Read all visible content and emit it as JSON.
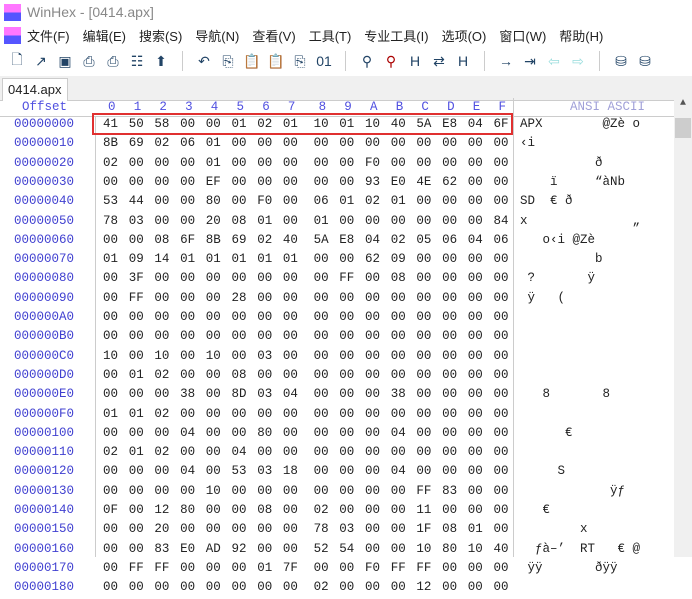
{
  "window": {
    "title": "WinHex - [0414.apx]"
  },
  "menu": [
    "文件(F)",
    "编辑(E)",
    "搜索(S)",
    "导航(N)",
    "查看(V)",
    "工具(T)",
    "专业工具(I)",
    "选项(O)",
    "窗口(W)",
    "帮助(H)"
  ],
  "toolbar": [
    "new-file",
    "open",
    "save",
    "print",
    "print-setup",
    "properties",
    "export",
    "undo",
    "copy",
    "paste",
    "paste-clipboard",
    "copy-block",
    "convert-binary",
    "find",
    "find-text",
    "find-hex",
    "replace",
    "replace-hex",
    "goto-offset",
    "goto-sector",
    "back",
    "forward",
    "disk-open",
    "disk-add"
  ],
  "tab": "0414.apx",
  "header": {
    "offset": "Offset",
    "columns": [
      "0",
      "1",
      "2",
      "3",
      "4",
      "5",
      "6",
      "7",
      "8",
      "9",
      "A",
      "B",
      "C",
      "D",
      "E",
      "F"
    ],
    "ascii": "ANSI ASCII"
  },
  "rows": [
    {
      "offset": "00000000",
      "hex": [
        "41",
        "50",
        "58",
        "00",
        "00",
        "01",
        "02",
        "01",
        "10",
        "01",
        "10",
        "40",
        "5A",
        "E8",
        "04",
        "6F"
      ],
      "ascii": "APX        @Zè o"
    },
    {
      "offset": "00000010",
      "hex": [
        "8B",
        "69",
        "02",
        "06",
        "01",
        "00",
        "00",
        "00",
        "00",
        "00",
        "00",
        "00",
        "00",
        "00",
        "00",
        "00"
      ],
      "ascii": "‹i              "
    },
    {
      "offset": "00000020",
      "hex": [
        "02",
        "00",
        "00",
        "00",
        "01",
        "00",
        "00",
        "00",
        "00",
        "00",
        "F0",
        "00",
        "00",
        "00",
        "00",
        "00"
      ],
      "ascii": "          ð     "
    },
    {
      "offset": "00000030",
      "hex": [
        "00",
        "00",
        "00",
        "00",
        "EF",
        "00",
        "00",
        "00",
        "00",
        "00",
        "93",
        "E0",
        "4E",
        "62",
        "00",
        "00"
      ],
      "ascii": "    ï     “àNb  "
    },
    {
      "offset": "00000040",
      "hex": [
        "53",
        "44",
        "00",
        "00",
        "80",
        "00",
        "F0",
        "00",
        "06",
        "01",
        "02",
        "01",
        "00",
        "00",
        "00",
        "00"
      ],
      "ascii": "SD  € ð         "
    },
    {
      "offset": "00000050",
      "hex": [
        "78",
        "03",
        "00",
        "00",
        "20",
        "08",
        "01",
        "00",
        "01",
        "00",
        "00",
        "00",
        "00",
        "00",
        "00",
        "84"
      ],
      "ascii": "x              „"
    },
    {
      "offset": "00000060",
      "hex": [
        "00",
        "00",
        "08",
        "6F",
        "8B",
        "69",
        "02",
        "40",
        "5A",
        "E8",
        "04",
        "02",
        "05",
        "06",
        "04",
        "06"
      ],
      "ascii": "   o‹i @Zè      "
    },
    {
      "offset": "00000070",
      "hex": [
        "01",
        "09",
        "14",
        "01",
        "01",
        "01",
        "01",
        "01",
        "00",
        "00",
        "62",
        "09",
        "00",
        "00",
        "00",
        "00"
      ],
      "ascii": "          b     "
    },
    {
      "offset": "00000080",
      "hex": [
        "00",
        "3F",
        "00",
        "00",
        "00",
        "00",
        "00",
        "00",
        "00",
        "FF",
        "00",
        "08",
        "00",
        "00",
        "00",
        "00"
      ],
      "ascii": " ?       ÿ      "
    },
    {
      "offset": "00000090",
      "hex": [
        "00",
        "FF",
        "00",
        "00",
        "00",
        "28",
        "00",
        "00",
        "00",
        "00",
        "00",
        "00",
        "00",
        "00",
        "00",
        "00"
      ],
      "ascii": " ÿ   (          "
    },
    {
      "offset": "000000A0",
      "hex": [
        "00",
        "00",
        "00",
        "00",
        "00",
        "00",
        "00",
        "00",
        "00",
        "00",
        "00",
        "00",
        "00",
        "00",
        "00",
        "00"
      ],
      "ascii": ""
    },
    {
      "offset": "000000B0",
      "hex": [
        "00",
        "00",
        "00",
        "00",
        "00",
        "00",
        "00",
        "00",
        "00",
        "00",
        "00",
        "00",
        "00",
        "00",
        "00",
        "00"
      ],
      "ascii": ""
    },
    {
      "offset": "000000C0",
      "hex": [
        "10",
        "00",
        "10",
        "00",
        "10",
        "00",
        "03",
        "00",
        "00",
        "00",
        "00",
        "00",
        "00",
        "00",
        "00",
        "00"
      ],
      "ascii": ""
    },
    {
      "offset": "000000D0",
      "hex": [
        "00",
        "01",
        "02",
        "00",
        "00",
        "08",
        "00",
        "00",
        "00",
        "00",
        "00",
        "00",
        "00",
        "00",
        "00",
        "00"
      ],
      "ascii": ""
    },
    {
      "offset": "000000E0",
      "hex": [
        "00",
        "00",
        "00",
        "38",
        "00",
        "8D",
        "03",
        "04",
        "00",
        "00",
        "00",
        "38",
        "00",
        "00",
        "00",
        "00"
      ],
      "ascii": "   8       8    "
    },
    {
      "offset": "000000F0",
      "hex": [
        "01",
        "01",
        "02",
        "00",
        "00",
        "00",
        "00",
        "00",
        "00",
        "00",
        "00",
        "00",
        "00",
        "00",
        "00",
        "00"
      ],
      "ascii": ""
    },
    {
      "offset": "00000100",
      "hex": [
        "00",
        "00",
        "00",
        "04",
        "00",
        "00",
        "80",
        "00",
        "00",
        "00",
        "00",
        "04",
        "00",
        "00",
        "00",
        "00"
      ],
      "ascii": "      €         "
    },
    {
      "offset": "00000110",
      "hex": [
        "02",
        "01",
        "02",
        "00",
        "00",
        "04",
        "00",
        "00",
        "00",
        "00",
        "00",
        "00",
        "00",
        "00",
        "00",
        "00"
      ],
      "ascii": ""
    },
    {
      "offset": "00000120",
      "hex": [
        "00",
        "00",
        "00",
        "04",
        "00",
        "53",
        "03",
        "18",
        "00",
        "00",
        "00",
        "04",
        "00",
        "00",
        "00",
        "00"
      ],
      "ascii": "     S          "
    },
    {
      "offset": "00000130",
      "hex": [
        "00",
        "00",
        "00",
        "00",
        "10",
        "00",
        "00",
        "00",
        "00",
        "00",
        "00",
        "00",
        "FF",
        "83",
        "00",
        "00"
      ],
      "ascii": "            ÿƒ  "
    },
    {
      "offset": "00000140",
      "hex": [
        "0F",
        "00",
        "12",
        "80",
        "00",
        "00",
        "08",
        "00",
        "02",
        "00",
        "00",
        "00",
        "11",
        "00",
        "00",
        "00"
      ],
      "ascii": "   €            "
    },
    {
      "offset": "00000150",
      "hex": [
        "00",
        "00",
        "20",
        "00",
        "00",
        "00",
        "00",
        "00",
        "78",
        "03",
        "00",
        "00",
        "1F",
        "08",
        "01",
        "00"
      ],
      "ascii": "        x       "
    },
    {
      "offset": "00000160",
      "hex": [
        "00",
        "00",
        "83",
        "E0",
        "AD",
        "92",
        "00",
        "00",
        "52",
        "54",
        "00",
        "00",
        "10",
        "80",
        "10",
        "40"
      ],
      "ascii": "  ƒà–’  RT   € @"
    },
    {
      "offset": "00000170",
      "hex": [
        "00",
        "FF",
        "FF",
        "00",
        "00",
        "00",
        "01",
        "7F",
        "00",
        "00",
        "F0",
        "FF",
        "FF",
        "00",
        "00",
        "00"
      ],
      "ascii": " ÿÿ       ðÿÿ   "
    },
    {
      "offset": "00000180",
      "hex": [
        "00",
        "00",
        "00",
        "00",
        "00",
        "00",
        "00",
        "00",
        "02",
        "00",
        "00",
        "00",
        "12",
        "00",
        "00",
        "00"
      ],
      "ascii": ""
    }
  ]
}
